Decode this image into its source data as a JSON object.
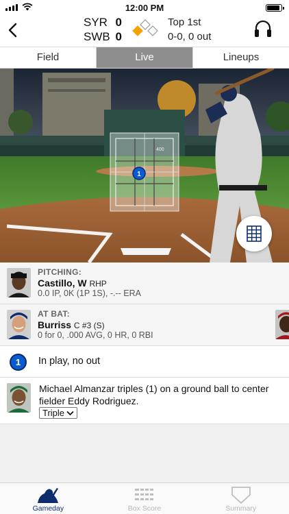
{
  "status_bar": {
    "time": "12:00 PM",
    "battery_fraction": 0.9
  },
  "scoreboard": {
    "away": {
      "team": "SYR",
      "score": "0"
    },
    "home": {
      "team": "SWB",
      "score": "0"
    },
    "inning": "Top 1st",
    "count": "0-0, 0 out",
    "bases_occupied": {
      "first": false,
      "second": false,
      "third": true
    },
    "icons": {
      "back": "chevron-left-icon",
      "audio": "headphones-icon",
      "bases": "bases-diamond-icon"
    }
  },
  "tabs": [
    {
      "label": "Field",
      "active": false
    },
    {
      "label": "Live",
      "active": true
    },
    {
      "label": "Lineups",
      "active": false
    }
  ],
  "strike_zone": {
    "pitch_number": "1",
    "velocity_label": "400"
  },
  "pitching": {
    "label": "PITCHING:",
    "name": "Castillo, W",
    "hand": "RHP",
    "stats": "0.0 IP, 0K (1P 1S), -.-- ERA"
  },
  "at_bat": {
    "label": "AT BAT:",
    "name": "Burriss",
    "position": "C #3 (S)",
    "stats": "0 for 0, .000 AVG, 0 HR, 0 RBI"
  },
  "play": {
    "pitch_number": "1",
    "result": "In play, no out"
  },
  "event": {
    "description": "Michael Almanzar triples (1) on a ground ball to center fielder Eddy Rodriguez.",
    "select_value": "Triple"
  },
  "bottom_nav": [
    {
      "label": "Gameday",
      "icon": "batter-icon",
      "active": true
    },
    {
      "label": "Box Score",
      "icon": "box-score-icon",
      "active": false
    },
    {
      "label": "Summary",
      "icon": "shield-icon",
      "active": false
    }
  ],
  "colors": {
    "accent": "#0d2d6c",
    "pitch_ball": "#0a5ad0",
    "base_occupied": "#f5a200",
    "active_tab": "#8e8e8e"
  }
}
